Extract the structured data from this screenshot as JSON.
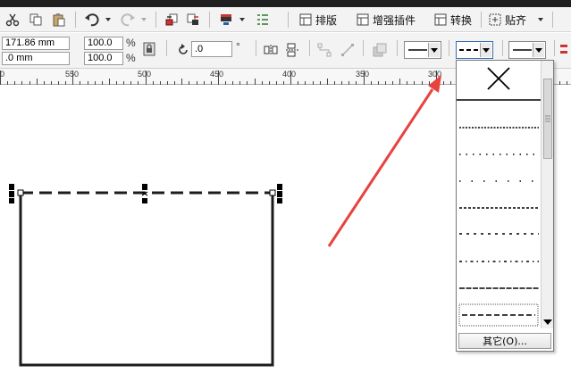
{
  "toolbar": {
    "layout_label": "排版",
    "enhance_label": "增强插件",
    "convert_label": "转换",
    "snap_label": "贴齐"
  },
  "properties": {
    "width_value": "171.86 mm",
    "height_value": ".0 mm",
    "scale_x": "100.0",
    "scale_y": "100.0",
    "percent": "%",
    "rotation_value": ".0",
    "degree": "°"
  },
  "ruler": {
    "labels": [
      "0",
      "550",
      "500",
      "450",
      "400",
      "350",
      "300"
    ]
  },
  "line_style_dropdown": {
    "more_label": "其它(O)..."
  },
  "colors": {
    "accent_arrow": "#e8423f",
    "toolbar_bg": "#f3f3f3"
  }
}
